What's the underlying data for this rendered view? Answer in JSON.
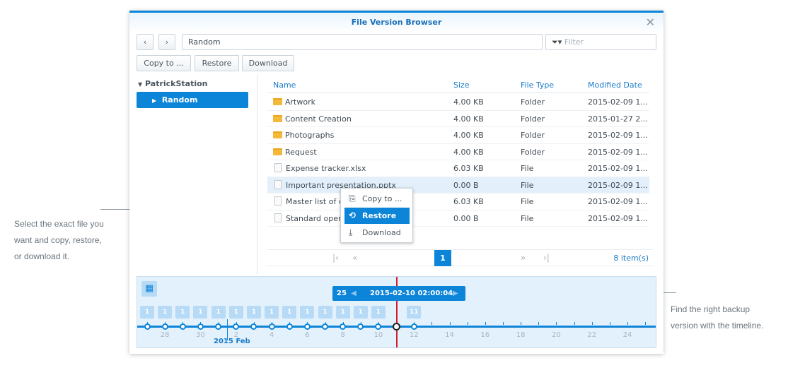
{
  "window": {
    "title": "File Version Browser",
    "close_icon": "close-icon"
  },
  "toolbar": {
    "back_icon": "chevron-left-icon",
    "forward_icon": "chevron-right-icon",
    "path": "Random",
    "filter_placeholder": "Filter",
    "copy_label": "Copy to ...",
    "restore_label": "Restore",
    "download_label": "Download"
  },
  "tree": {
    "root": "PatrickStation",
    "child": "Random"
  },
  "table": {
    "columns": [
      "Name",
      "Size",
      "File Type",
      "Modified Date"
    ],
    "rows": [
      {
        "name": "Artwork",
        "size": "4.00 KB",
        "type": "Folder",
        "date": "2015-02-09 1...",
        "icon": "folder"
      },
      {
        "name": "Content Creation",
        "size": "4.00 KB",
        "type": "Folder",
        "date": "2015-01-27 2...",
        "icon": "folder"
      },
      {
        "name": "Photographs",
        "size": "4.00 KB",
        "type": "Folder",
        "date": "2015-02-09 1...",
        "icon": "folder"
      },
      {
        "name": "Request",
        "size": "4.00 KB",
        "type": "Folder",
        "date": "2015-02-09 1...",
        "icon": "folder"
      },
      {
        "name": "Expense tracker.xlsx",
        "size": "6.03 KB",
        "type": "File",
        "date": "2015-02-09 1...",
        "icon": "file"
      },
      {
        "name": "Important presentation.pptx",
        "size": "0.00 B",
        "type": "File",
        "date": "2015-02-09 1...",
        "icon": "file"
      },
      {
        "name": "Master list of co",
        "size": "6.03 KB",
        "type": "File",
        "date": "2015-02-09 1...",
        "icon": "file"
      },
      {
        "name": "Standard operat",
        "size": "0.00 B",
        "type": "File",
        "date": "2015-02-09 1...",
        "icon": "file"
      }
    ],
    "selected_row": 5
  },
  "context_menu": {
    "items": [
      "Copy to ...",
      "Restore",
      "Download"
    ],
    "active": "Restore"
  },
  "pagination": {
    "page": "1",
    "count": "8 item(s)"
  },
  "timeline": {
    "version_count": "25",
    "current": "2015-02-10 02:00:04",
    "month_label": "2015 Feb",
    "day_labels": [
      "28",
      "30",
      "2",
      "4",
      "6",
      "8",
      "10",
      "12",
      "14",
      "16",
      "18",
      "20",
      "22",
      "24"
    ],
    "versions": [
      "1",
      "1",
      "1",
      "1",
      "1",
      "1",
      "1",
      "1",
      "1",
      "1",
      "1",
      "1",
      "1",
      "1",
      "",
      "11"
    ],
    "accent": "#0c84d8",
    "cursor_color": "#d0202a"
  },
  "notes": {
    "left": [
      "Select the exact file you",
      "want and copy, restore,",
      "or download it."
    ],
    "right": [
      "Find the right backup",
      "version with the timeline."
    ]
  }
}
